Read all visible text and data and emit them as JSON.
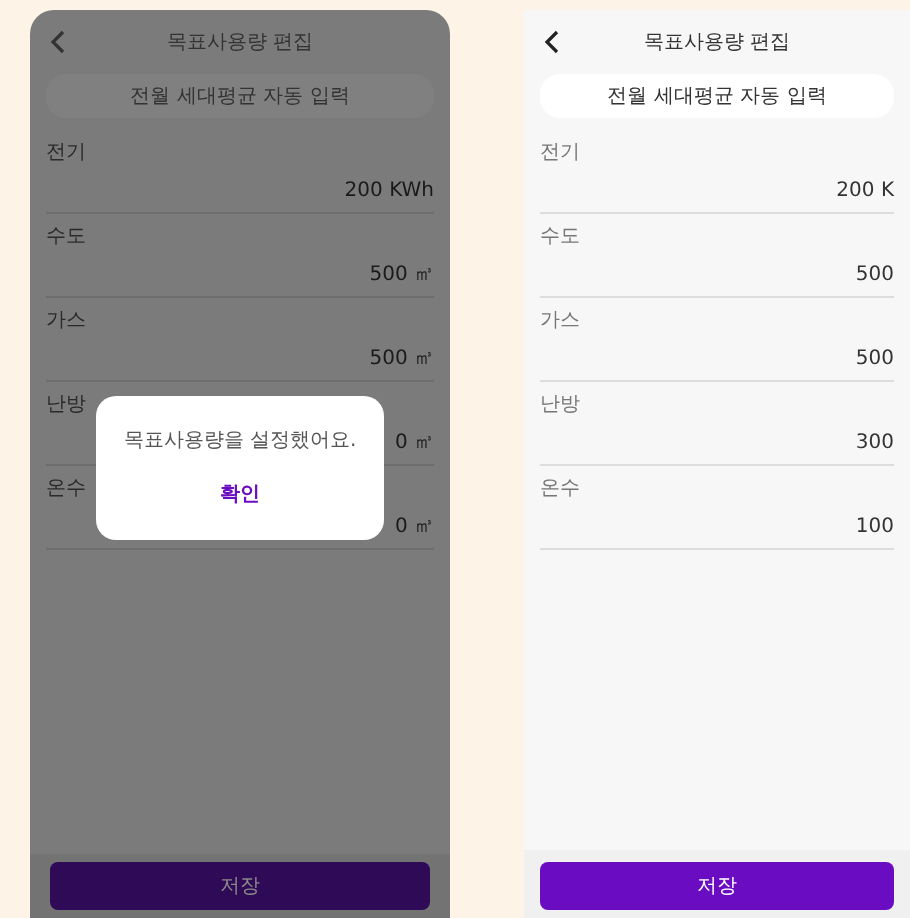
{
  "screens": [
    {
      "title": "목표사용량 편집",
      "autofill_button": "전월 세대평균 자동 입력",
      "dimmed": true,
      "fields": [
        {
          "label": "전기",
          "value": "200 KWh"
        },
        {
          "label": "수도",
          "value": "500 ㎥"
        },
        {
          "label": "가스",
          "value": "500 ㎥"
        },
        {
          "label": "난방",
          "value": "0 ㎥"
        },
        {
          "label": "온수",
          "value": "0 ㎥"
        }
      ],
      "dialog": {
        "message": "목표사용량을 설정했어요.",
        "confirm": "확인"
      },
      "save_button": "저장"
    },
    {
      "title": "목표사용량 편집",
      "autofill_button": "전월 세대평균 자동 입력",
      "dimmed": false,
      "fields": [
        {
          "label": "전기",
          "value": "200 K"
        },
        {
          "label": "수도",
          "value": "500"
        },
        {
          "label": "가스",
          "value": "500"
        },
        {
          "label": "난방",
          "value": "300"
        },
        {
          "label": "온수",
          "value": "100"
        }
      ],
      "save_button": "저장"
    }
  ]
}
